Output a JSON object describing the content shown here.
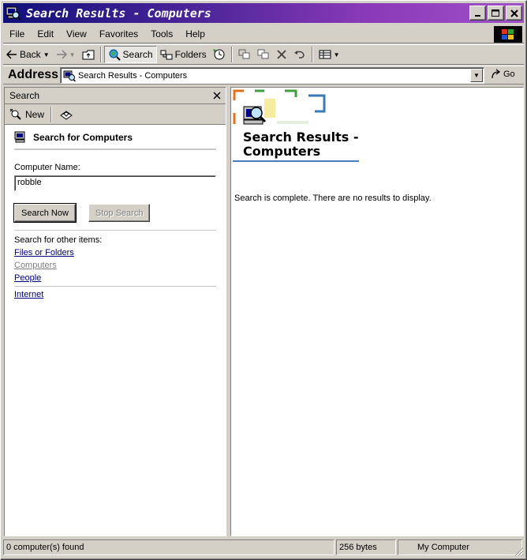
{
  "window": {
    "title": "Search Results - Computers"
  },
  "menu": [
    "File",
    "Edit",
    "View",
    "Favorites",
    "Tools",
    "Help"
  ],
  "toolbar": {
    "back": "Back",
    "search": "Search",
    "folders": "Folders"
  },
  "address": {
    "label": "Address",
    "value": "Search Results - Computers",
    "go": "Go"
  },
  "search_pane": {
    "header": "Search",
    "new_label": "New",
    "heading": "Search for Computers",
    "computer_name_label": "Computer Name:",
    "computer_name_value": "robble",
    "search_now": "Search Now",
    "stop_search": "Stop Search",
    "other_items_label": "Search for other items:",
    "links": [
      "Files or Folders",
      "Computers",
      "People"
    ],
    "internet": "Internet"
  },
  "results": {
    "title_line1": "Search Results -",
    "title_line2": "Computers",
    "message": "Search is complete. There are no results to display."
  },
  "status": {
    "count": "0 computer(s) found",
    "size": "256 bytes",
    "zone": "My Computer"
  },
  "colors": {
    "titlebar_start": "#10107a",
    "titlebar_end": "#a050c8",
    "link": "#000080",
    "rule": "#4a7db8"
  }
}
